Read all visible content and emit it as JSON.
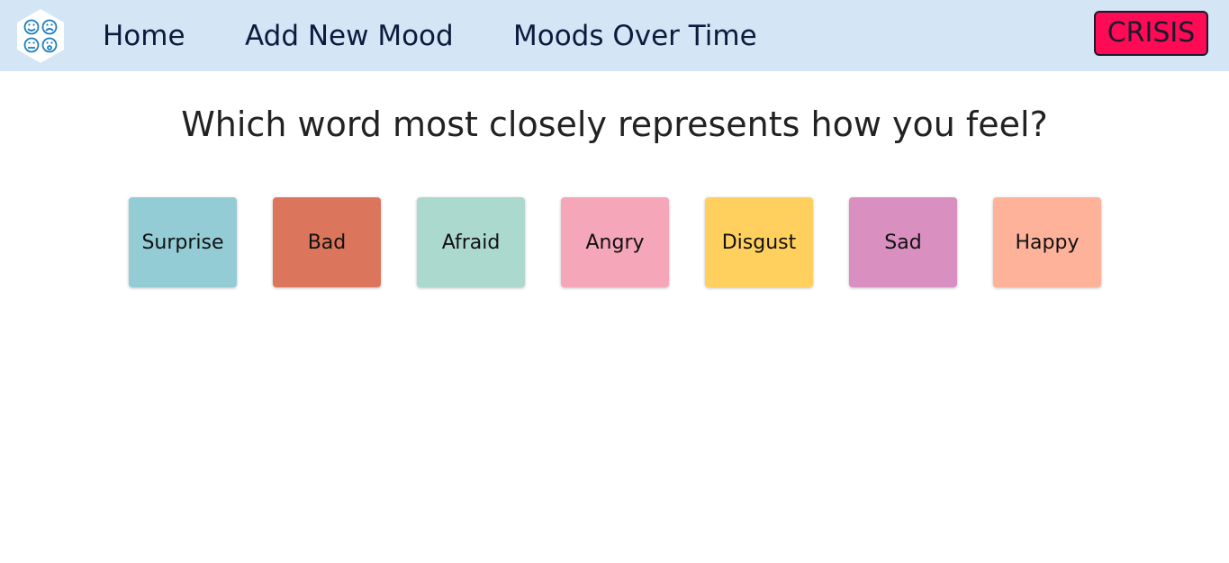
{
  "nav": {
    "home": "Home",
    "add_new_mood": "Add New Mood",
    "moods_over_time": "Moods Over Time",
    "crisis": "CRISIS",
    "logo_icon": "mood-faces-hexagon-icon",
    "crisis_color": "#ff0a54",
    "nav_bg": "#d4e5f6"
  },
  "prompt": {
    "question": "Which word most closely represents how you feel?"
  },
  "moods": [
    {
      "label": "Surprise",
      "color": "#93ccd5"
    },
    {
      "label": "Bad",
      "color": "#db765c"
    },
    {
      "label": "Afraid",
      "color": "#acd9cd"
    },
    {
      "label": "Angry",
      "color": "#f5a6b8"
    },
    {
      "label": "Disgust",
      "color": "#ffd05e"
    },
    {
      "label": "Sad",
      "color": "#d98fbf"
    },
    {
      "label": "Happy",
      "color": "#feb29a"
    }
  ]
}
